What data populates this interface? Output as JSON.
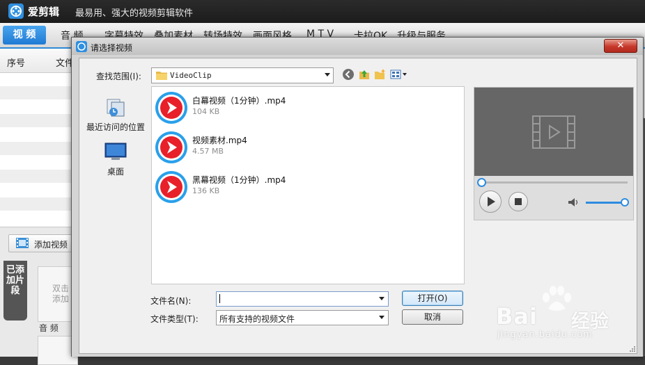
{
  "app": {
    "name": "爱剪辑",
    "slogan": "最易用、强大的视频剪辑软件",
    "tabs": [
      "视 频",
      "音 频",
      "字幕特效",
      "叠加素材",
      "转场特效",
      "画面风格",
      "M T V",
      "卡拉OK",
      "升级与服务"
    ]
  },
  "clip_list": {
    "columns": [
      "序号",
      "文件"
    ]
  },
  "lower": {
    "add_video": "添加视频",
    "added_clips_tab": "已添加片段",
    "drop_hint": "双击添加",
    "audio_label": "音 频"
  },
  "dialog": {
    "title": "请选择视频",
    "close_symbol": "✕",
    "look_in_label": "查找范围(I):",
    "look_in_value": "VideoClip",
    "places": [
      {
        "label": "最近访问的位置",
        "icon": "recent-places-icon"
      },
      {
        "label": "桌面",
        "icon": "desktop-icon"
      }
    ],
    "files": [
      {
        "name": "白幕视频（1分钟）.mp4",
        "size": "104 KB"
      },
      {
        "name": "视频素材.mp4",
        "size": "4.57 MB"
      },
      {
        "name": "黑幕视频（1分钟）.mp4",
        "size": "136 KB"
      }
    ],
    "file_name_label": "文件名(N):",
    "file_name_value": "",
    "file_type_label": "文件类型(T):",
    "file_type_value": "所有支持的视频文件",
    "open_button": "打开(O)",
    "cancel_button": "取消"
  },
  "preview": {
    "seek_progress": 0.02,
    "volume_level": 0.9
  },
  "watermark": {
    "brand_latin": "Bai",
    "brand_cn": "经验",
    "url": "jingyan.baidu.com"
  },
  "colors": {
    "accent": "#2e8ad8",
    "file_icon_red": "#e8202a",
    "file_icon_blue": "#2aa0ea"
  }
}
